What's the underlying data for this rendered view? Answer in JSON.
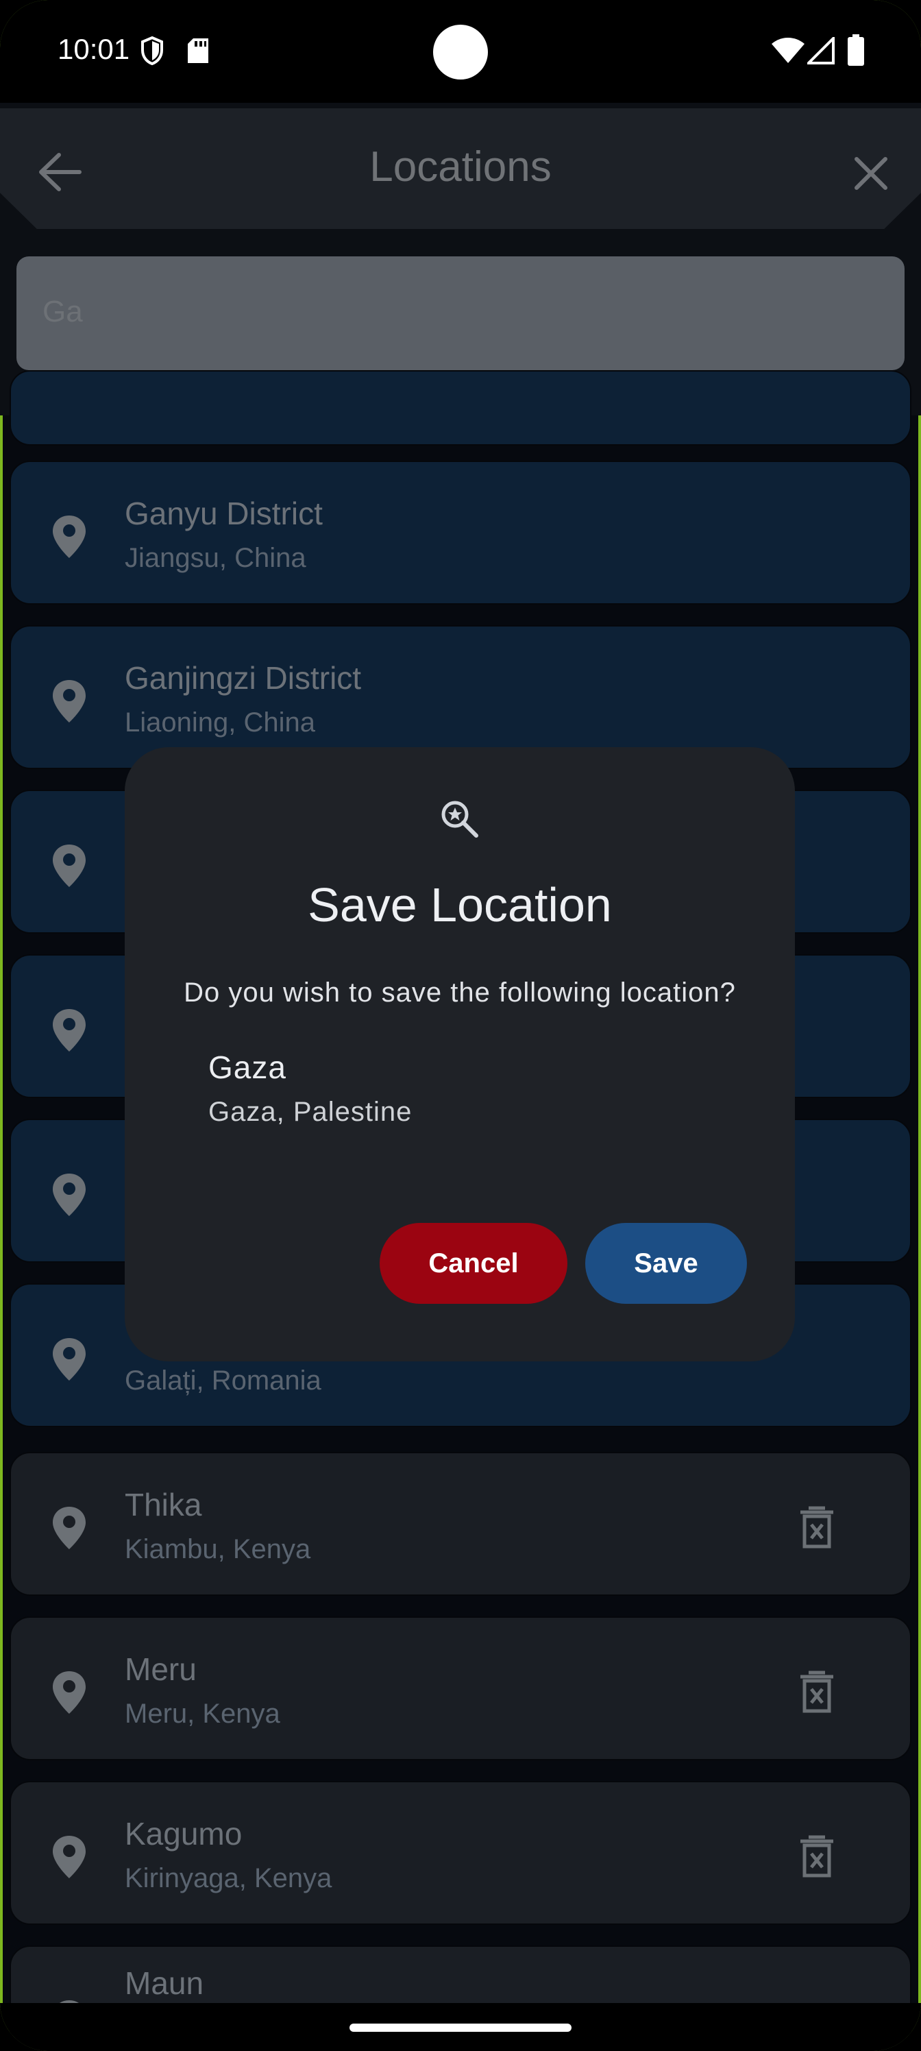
{
  "status_bar": {
    "time": "10:01"
  },
  "app_bar": {
    "title": "Locations"
  },
  "search": {
    "value": "Ga"
  },
  "locations": [
    {
      "name": "Ganyu District",
      "sub": "Jiangsu, China"
    },
    {
      "name": "Ganjingzi District",
      "sub": "Liaoning, China"
    },
    {
      "name": "",
      "sub": "Galați, Romania"
    },
    {
      "name": "Thika",
      "sub": "Kiambu, Kenya"
    },
    {
      "name": "Meru",
      "sub": "Meru, Kenya"
    },
    {
      "name": "Kagumo",
      "sub": "Kirinyaga, Kenya"
    },
    {
      "name": "Maun",
      "sub": ""
    }
  ],
  "dialog": {
    "title": "Save Location",
    "message": "Do you wish to save the following location?",
    "location_name": "Gaza",
    "location_sub": "Gaza, Palestine",
    "cancel_label": "Cancel",
    "save_label": "Save"
  },
  "colors": {
    "accent": "#1c4e85",
    "danger": "#9b0411"
  }
}
